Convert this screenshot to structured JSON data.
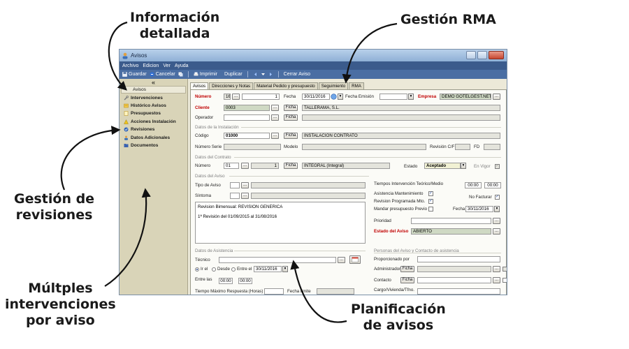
{
  "callouts": {
    "info_detallada_line1": "Información",
    "info_detallada_line2": "detallada",
    "gestion_rma": "Gestión RMA",
    "gestion_revisiones_line1": "Gestión de",
    "gestion_revisiones_line2": "revisiones",
    "multiples_line1": "Múltples",
    "multiples_line2": "intervenciones",
    "multiples_line3": "por aviso",
    "planificacion_line1": "Planificación",
    "planificacion_line2": "de avisos"
  },
  "window": {
    "title": "Avisos",
    "menu": [
      "Archivo",
      "Edicion",
      "Ver",
      "Ayuda"
    ],
    "toolbar": {
      "guardar": "Guardar",
      "cancelar": "Cancelar",
      "imprimir": "Imprimir",
      "duplicar": "Duplicar",
      "cerrar": "Cerrar Aviso"
    }
  },
  "sidebar": {
    "collapse": "«",
    "items": [
      "Avisos",
      "Intervenciones",
      "Histórico Avisos",
      "Presupuestos",
      "Acciones Instalación",
      "Revisiones",
      "Datos Adicionales",
      "Documentos"
    ]
  },
  "tabs": [
    "Avisos",
    "Direcciones y Notas",
    "Material Pedido y presupuesto",
    "Seguimiento",
    "RMA"
  ],
  "form": {
    "numero_label": "Número",
    "numero_serie": "16",
    "numero_value": "1",
    "fecha_label": "Fecha",
    "fecha_value": "30/11/2016",
    "fecha_emision_label": "Fecha Emisión",
    "empresa_label": "Empresa",
    "empresa_value": "DEMO GOTELGEST.NET",
    "cliente_label": "Cliente",
    "cliente_code": "0003",
    "ficha": "Ficha",
    "cliente_name": "TALLERAMA, S.L.",
    "operador_label": "Operador",
    "dots": "...",
    "sec_instalacion": "Datos de la Instalación",
    "codigo_label": "Código",
    "codigo_value": "01000",
    "instalacion_name": "INSTALACION CONTRATO",
    "numero_serie_label": "Número Serie",
    "modelo_label": "Modelo",
    "revision_cf_label": "Revisión C/F",
    "fd_label": "FD",
    "sec_contrato": "Datos del Contrato",
    "contrato_numero_label": "Número",
    "contrato_serie": "01",
    "contrato_numero": "1",
    "contrato_tipo": "INTEGRAL (Integral)",
    "estado_label": "Estado",
    "estado_value": "Aceptado",
    "en_vigor_label": "En Vigor",
    "sec_aviso": "Datos del Aviso",
    "tipo_aviso_label": "Tipo de Aviso",
    "sintoma_label": "Síntoma",
    "nota_line1": "Revision Bimensual: REVISION GENERICA",
    "nota_line2": "1ª Revisión del 01/09/2015 al 31/08/2016",
    "tiempos_label": "Tiempos Intervención Teórico/Medio",
    "tiempo_teorico": "00:00",
    "tiempo_medio": "00:00",
    "asistencia_label": "Asistencia Mantenimiento",
    "no_facturar_label": "No Facturar",
    "revision_prog_label": "Revision Programada Mto.",
    "mandar_presupuesto_label": "Mandar presupuesto Previo",
    "fecha2_label": "Fecha",
    "fecha2_value": "30/11/2016",
    "prioridad_label": "Prioridad",
    "estado_aviso_label": "Estado del Aviso",
    "estado_aviso_value": "ABIERTO",
    "sec_asistencia": "Datos de Asistencia",
    "tecnico_label": "Técnico",
    "radio_el": "Ir el",
    "radio_desde": "Desde",
    "radio_entre": "Entre el",
    "asist_fecha": "30/11/2016",
    "entre_las_label": "Entre las",
    "hora_1": "00:00",
    "hora_2": "00:00",
    "tiempo_max_label": "Tiempo Máximo Respuesta (Horas)",
    "fecha_limite_label": "Fecha límite",
    "sec_personas": "Personas del Aviso y Contacto de asistencia",
    "proporcionado_label": "Proporcionado por",
    "administrador_label": "Administrador",
    "contacto_label": "Contacto",
    "cargo_label": "Cargo/Vivienda/Tfno."
  }
}
